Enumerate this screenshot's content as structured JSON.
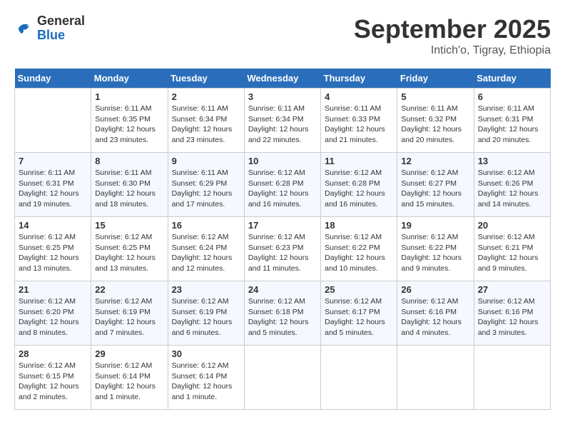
{
  "logo": {
    "general": "General",
    "blue": "Blue"
  },
  "title": "September 2025",
  "subtitle": "Intich'o, Tigray, Ethiopia",
  "days_of_week": [
    "Sunday",
    "Monday",
    "Tuesday",
    "Wednesday",
    "Thursday",
    "Friday",
    "Saturday"
  ],
  "weeks": [
    [
      {
        "day": "",
        "info": ""
      },
      {
        "day": "1",
        "info": "Sunrise: 6:11 AM\nSunset: 6:35 PM\nDaylight: 12 hours\nand 23 minutes."
      },
      {
        "day": "2",
        "info": "Sunrise: 6:11 AM\nSunset: 6:34 PM\nDaylight: 12 hours\nand 23 minutes."
      },
      {
        "day": "3",
        "info": "Sunrise: 6:11 AM\nSunset: 6:34 PM\nDaylight: 12 hours\nand 22 minutes."
      },
      {
        "day": "4",
        "info": "Sunrise: 6:11 AM\nSunset: 6:33 PM\nDaylight: 12 hours\nand 21 minutes."
      },
      {
        "day": "5",
        "info": "Sunrise: 6:11 AM\nSunset: 6:32 PM\nDaylight: 12 hours\nand 20 minutes."
      },
      {
        "day": "6",
        "info": "Sunrise: 6:11 AM\nSunset: 6:31 PM\nDaylight: 12 hours\nand 20 minutes."
      }
    ],
    [
      {
        "day": "7",
        "info": "Sunrise: 6:11 AM\nSunset: 6:31 PM\nDaylight: 12 hours\nand 19 minutes."
      },
      {
        "day": "8",
        "info": "Sunrise: 6:11 AM\nSunset: 6:30 PM\nDaylight: 12 hours\nand 18 minutes."
      },
      {
        "day": "9",
        "info": "Sunrise: 6:11 AM\nSunset: 6:29 PM\nDaylight: 12 hours\nand 17 minutes."
      },
      {
        "day": "10",
        "info": "Sunrise: 6:12 AM\nSunset: 6:28 PM\nDaylight: 12 hours\nand 16 minutes."
      },
      {
        "day": "11",
        "info": "Sunrise: 6:12 AM\nSunset: 6:28 PM\nDaylight: 12 hours\nand 16 minutes."
      },
      {
        "day": "12",
        "info": "Sunrise: 6:12 AM\nSunset: 6:27 PM\nDaylight: 12 hours\nand 15 minutes."
      },
      {
        "day": "13",
        "info": "Sunrise: 6:12 AM\nSunset: 6:26 PM\nDaylight: 12 hours\nand 14 minutes."
      }
    ],
    [
      {
        "day": "14",
        "info": "Sunrise: 6:12 AM\nSunset: 6:25 PM\nDaylight: 12 hours\nand 13 minutes."
      },
      {
        "day": "15",
        "info": "Sunrise: 6:12 AM\nSunset: 6:25 PM\nDaylight: 12 hours\nand 13 minutes."
      },
      {
        "day": "16",
        "info": "Sunrise: 6:12 AM\nSunset: 6:24 PM\nDaylight: 12 hours\nand 12 minutes."
      },
      {
        "day": "17",
        "info": "Sunrise: 6:12 AM\nSunset: 6:23 PM\nDaylight: 12 hours\nand 11 minutes."
      },
      {
        "day": "18",
        "info": "Sunrise: 6:12 AM\nSunset: 6:22 PM\nDaylight: 12 hours\nand 10 minutes."
      },
      {
        "day": "19",
        "info": "Sunrise: 6:12 AM\nSunset: 6:22 PM\nDaylight: 12 hours\nand 9 minutes."
      },
      {
        "day": "20",
        "info": "Sunrise: 6:12 AM\nSunset: 6:21 PM\nDaylight: 12 hours\nand 9 minutes."
      }
    ],
    [
      {
        "day": "21",
        "info": "Sunrise: 6:12 AM\nSunset: 6:20 PM\nDaylight: 12 hours\nand 8 minutes."
      },
      {
        "day": "22",
        "info": "Sunrise: 6:12 AM\nSunset: 6:19 PM\nDaylight: 12 hours\nand 7 minutes."
      },
      {
        "day": "23",
        "info": "Sunrise: 6:12 AM\nSunset: 6:19 PM\nDaylight: 12 hours\nand 6 minutes."
      },
      {
        "day": "24",
        "info": "Sunrise: 6:12 AM\nSunset: 6:18 PM\nDaylight: 12 hours\nand 5 minutes."
      },
      {
        "day": "25",
        "info": "Sunrise: 6:12 AM\nSunset: 6:17 PM\nDaylight: 12 hours\nand 5 minutes."
      },
      {
        "day": "26",
        "info": "Sunrise: 6:12 AM\nSunset: 6:16 PM\nDaylight: 12 hours\nand 4 minutes."
      },
      {
        "day": "27",
        "info": "Sunrise: 6:12 AM\nSunset: 6:16 PM\nDaylight: 12 hours\nand 3 minutes."
      }
    ],
    [
      {
        "day": "28",
        "info": "Sunrise: 6:12 AM\nSunset: 6:15 PM\nDaylight: 12 hours\nand 2 minutes."
      },
      {
        "day": "29",
        "info": "Sunrise: 6:12 AM\nSunset: 6:14 PM\nDaylight: 12 hours\nand 1 minute."
      },
      {
        "day": "30",
        "info": "Sunrise: 6:12 AM\nSunset: 6:14 PM\nDaylight: 12 hours\nand 1 minute."
      },
      {
        "day": "",
        "info": ""
      },
      {
        "day": "",
        "info": ""
      },
      {
        "day": "",
        "info": ""
      },
      {
        "day": "",
        "info": ""
      }
    ]
  ]
}
